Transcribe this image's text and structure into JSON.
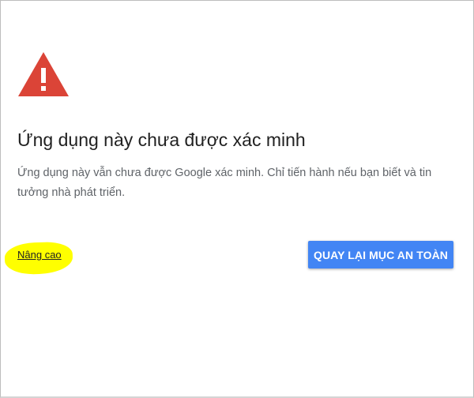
{
  "dialog": {
    "icon": "warning-triangle-icon",
    "title": "Ứng dụng này chưa được xác minh",
    "message_line1": "Ứng dụng này vẫn chưa được Google xác minh. Chỉ tiến hành nếu bạn biết và tin",
    "message_line2": "tưởng nhà phát triển.",
    "advanced_link": "Nâng cao",
    "back_to_safety_button": "QUAY LẠI MỤC AN TOÀN"
  },
  "colors": {
    "warning_red": "#db4437",
    "button_blue": "#4285f4",
    "highlight_yellow": "#ffff00"
  }
}
